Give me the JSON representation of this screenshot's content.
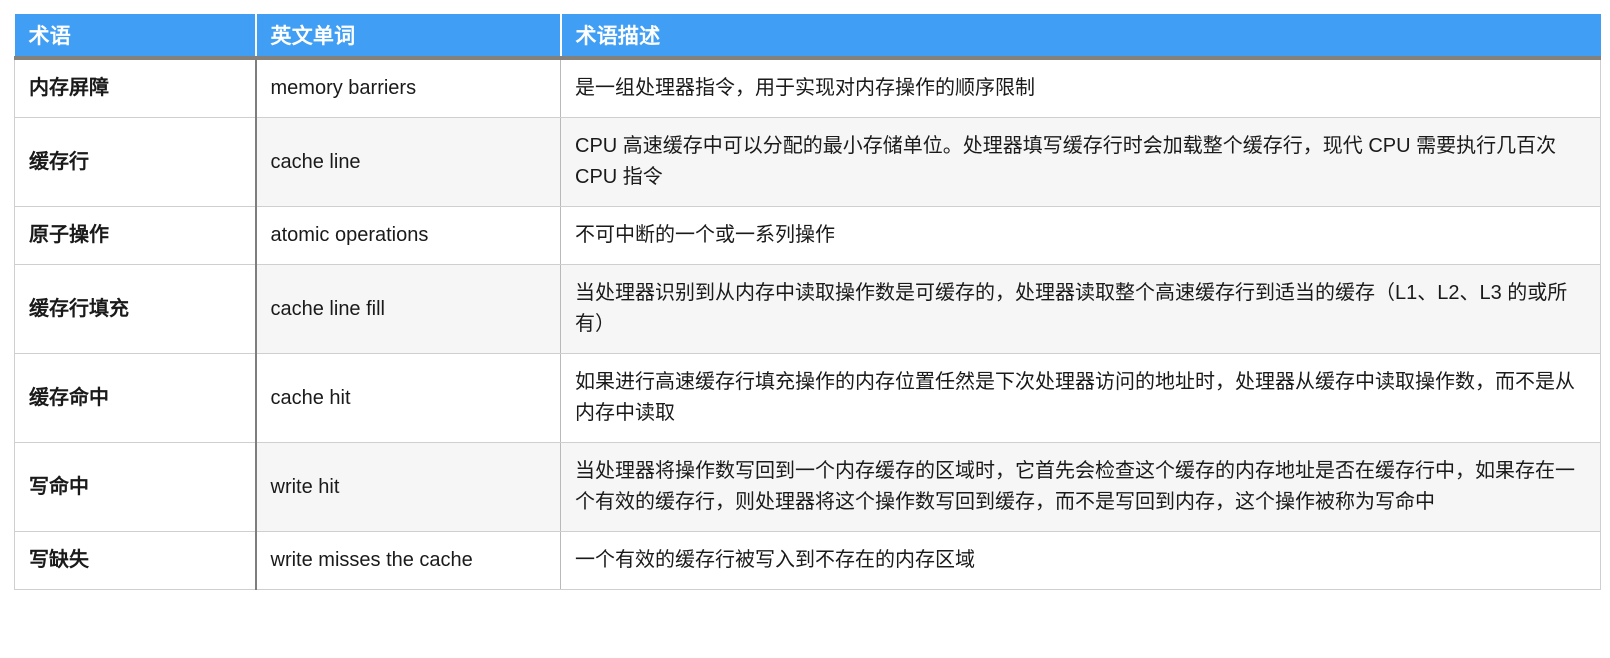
{
  "table": {
    "columns": [
      {
        "key": "term",
        "label": "术语"
      },
      {
        "key": "english",
        "label": "英文单词"
      },
      {
        "key": "description",
        "label": "术语描述"
      }
    ],
    "header_bg": "#409ef4",
    "header_text_color": "#ffffff",
    "stripe_bg": "#f6f6f6",
    "rows": [
      {
        "term": "内存屏障",
        "english": "memory barriers",
        "description": "是一组处理器指令，用于实现对内存操作的顺序限制"
      },
      {
        "term": "缓存行",
        "english": "cache line",
        "description": "CPU 高速缓存中可以分配的最小存储单位。处理器填写缓存行时会加载整个缓存行，现代 CPU 需要执行几百次 CPU 指令"
      },
      {
        "term": "原子操作",
        "english": "atomic operations",
        "description": "不可中断的一个或一系列操作"
      },
      {
        "term": "缓存行填充",
        "english": "cache line fill",
        "description": "当处理器识别到从内存中读取操作数是可缓存的，处理器读取整个高速缓存行到适当的缓存（L1、L2、L3 的或所有）"
      },
      {
        "term": "缓存命中",
        "english": "cache hit",
        "description": "如果进行高速缓存行填充操作的内存位置任然是下次处理器访问的地址时，处理器从缓存中读取操作数，而不是从内存中读取"
      },
      {
        "term": "写命中",
        "english": "write hit",
        "description": "当处理器将操作数写回到一个内存缓存的区域时，它首先会检查这个缓存的内存地址是否在缓存行中，如果存在一个有效的缓存行，则处理器将这个操作数写回到缓存，而不是写回到内存，这个操作被称为写命中"
      },
      {
        "term": "写缺失",
        "english": "write misses the cache",
        "description": "一个有效的缓存行被写入到不存在的内存区域"
      }
    ]
  }
}
